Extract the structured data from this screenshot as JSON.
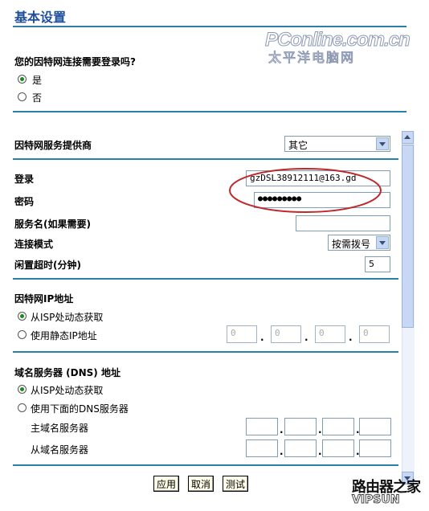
{
  "page": {
    "title": "基本设置",
    "watermark_top": "PConline.com.cn",
    "watermark_sub": "太平洋电脑网",
    "watermark_bottom": "路由器之家",
    "watermark_bottom2": "VIPSUN"
  },
  "login_question": {
    "label": "您的因特网连接需要登录吗?",
    "options": [
      "是",
      "否"
    ],
    "selected": "是"
  },
  "isp": {
    "label": "因特网服务提供商",
    "selected": "其它"
  },
  "credentials": {
    "login_label": "登录",
    "login_value": "gzDSL38912111@163.gd",
    "password_label": "密码",
    "password_mask": "●●●●●●●●●",
    "service_label": "服务名(如果需要)",
    "service_value": "",
    "mode_label": "连接模式",
    "mode_value": "按需拨号",
    "idle_label": "闲置超时(分钟)",
    "idle_value": "5"
  },
  "ip": {
    "header": "因特网IP地址",
    "dynamic_label": "从ISP处动态获取",
    "static_label": "使用静态IP地址",
    "selected": "dynamic",
    "octets": [
      "0",
      "0",
      "0",
      "0"
    ]
  },
  "dns": {
    "header": "域名服务器 (DNS) 地址",
    "dynamic_label": "从ISP处动态获取",
    "manual_label": "使用下面的DNS服务器",
    "selected": "dynamic",
    "primary_label": "主域名服务器",
    "secondary_label": "从域名服务器"
  },
  "buttons": {
    "apply": "应用",
    "cancel": "取消",
    "test": "测试"
  },
  "colors": {
    "accent": "#1e4f9a",
    "divider": "#2e7fa6",
    "annotation_ellipse": "#c0282a"
  }
}
